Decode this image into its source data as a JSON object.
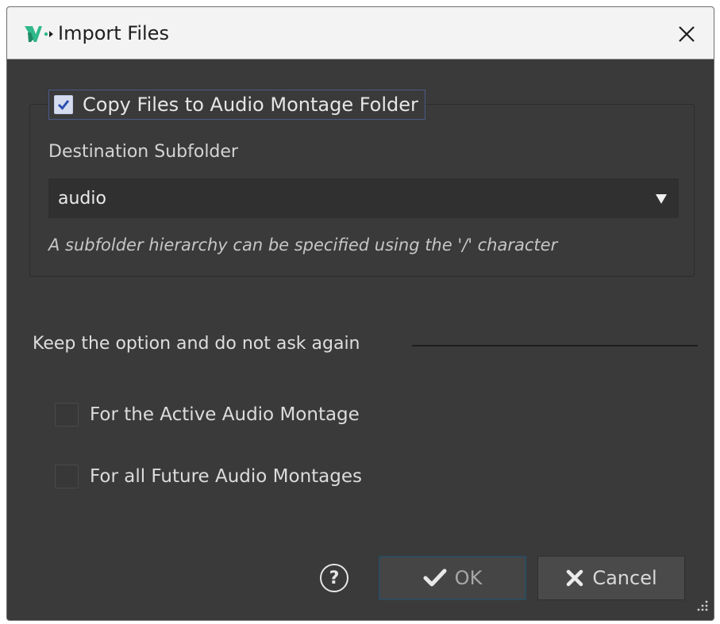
{
  "window": {
    "title": "Import Files",
    "app_icon": "wavelab-logo-icon",
    "close_icon": "close-icon"
  },
  "copy_section": {
    "checkbox_label": "Copy Files to Audio Montage Folder",
    "checked": true,
    "destination_label": "Destination Subfolder",
    "destination_value": "audio",
    "hint": "A subfolder hierarchy can be specified using the '/' character"
  },
  "keep_section": {
    "heading": "Keep the option and do not ask again",
    "options": [
      {
        "label": "For the Active Audio Montage",
        "checked": false
      },
      {
        "label": "For all Future Audio Montages",
        "checked": false
      }
    ]
  },
  "buttons": {
    "help": "?",
    "ok": "OK",
    "cancel": "Cancel"
  },
  "colors": {
    "dialog_bg": "#3a3a3a",
    "titlebar_bg": "#f3f3f3",
    "accent_green": "#2fb88a"
  }
}
